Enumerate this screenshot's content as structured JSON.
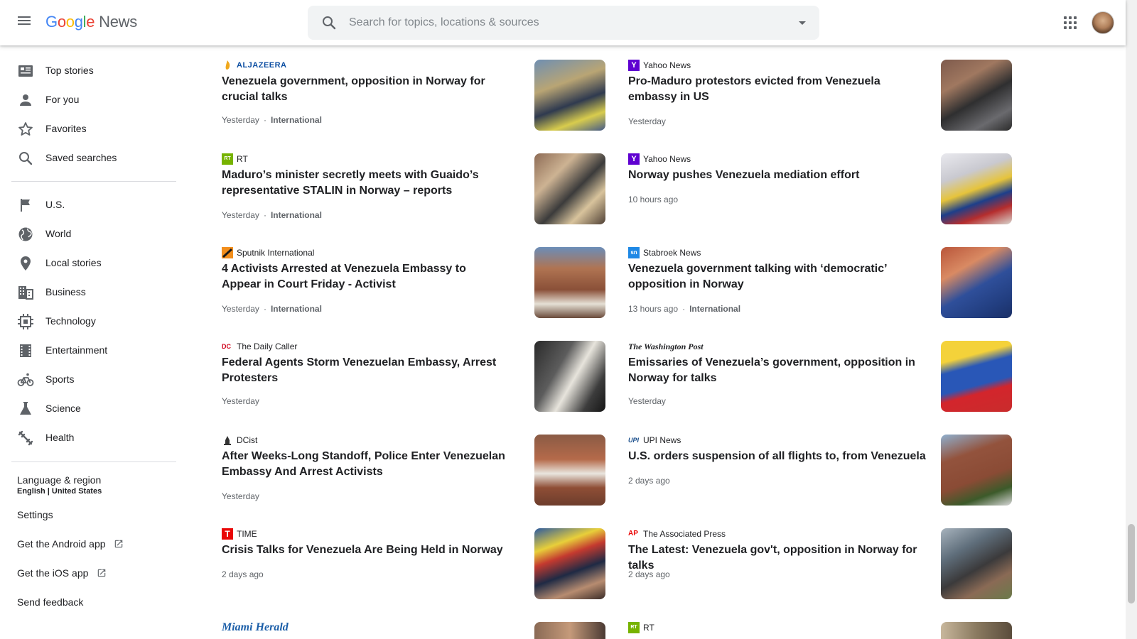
{
  "header": {
    "logo_google": [
      "G",
      "o",
      "o",
      "g",
      "l",
      "e"
    ],
    "logo_news": "News",
    "search_placeholder": "Search for topics, locations & sources"
  },
  "sidebar": {
    "items": [
      {
        "label": "Top stories",
        "icon": "top-stories-icon"
      },
      {
        "label": "For you",
        "icon": "person-icon"
      },
      {
        "label": "Favorites",
        "icon": "star-icon"
      },
      {
        "label": "Saved searches",
        "icon": "search-icon"
      },
      {
        "label": "U.S.",
        "icon": "flag-icon"
      },
      {
        "label": "World",
        "icon": "globe-icon"
      },
      {
        "label": "Local stories",
        "icon": "location-pin-icon"
      },
      {
        "label": "Business",
        "icon": "business-icon"
      },
      {
        "label": "Technology",
        "icon": "chip-icon"
      },
      {
        "label": "Entertainment",
        "icon": "film-icon"
      },
      {
        "label": "Sports",
        "icon": "bike-icon"
      },
      {
        "label": "Science",
        "icon": "flask-icon"
      },
      {
        "label": "Health",
        "icon": "dumbbell-icon"
      }
    ],
    "language_label": "Language & region",
    "language_value": "English | United States",
    "settings": "Settings",
    "android": "Get the Android app",
    "ios": "Get the iOS app",
    "feedback": "Send feedback"
  },
  "articles_left": [
    {
      "source": "ALJAZEERA",
      "title": "Venezuela government, opposition in Norway for crucial talks",
      "time": "Yesterday",
      "category": "International",
      "favicon": "aljazeera-icon"
    },
    {
      "source": "RT",
      "title": "Maduro’s minister secretly meets with Guaido’s representative STALIN in Norway – reports",
      "time": "Yesterday",
      "category": "International",
      "favicon": "rt-icon"
    },
    {
      "source": "Sputnik International",
      "title": "4 Activists Arrested at Venezuela Embassy to Appear in Court Friday - Activist",
      "time": "Yesterday",
      "category": "International",
      "favicon": "sputnik-icon"
    },
    {
      "source": "The Daily Caller",
      "title": "Federal Agents Storm Venezuelan Embassy, Arrest Protesters",
      "time": "Yesterday",
      "category": "",
      "favicon": "daily-caller-icon"
    },
    {
      "source": "DCist",
      "title": "After Weeks-Long Standoff, Police Enter Venezuelan Embassy And Arrest Activists",
      "time": "Yesterday",
      "category": "",
      "favicon": "dcist-icon"
    },
    {
      "source": "TIME",
      "title": "Crisis Talks for Venezuela Are Being Held in Norway",
      "time": "2 days ago",
      "category": "",
      "favicon": "time-icon"
    },
    {
      "source": "Miami Herald",
      "title": "",
      "time": "",
      "category": "",
      "favicon": "miami-herald-icon"
    }
  ],
  "articles_right": [
    {
      "source": "Yahoo News",
      "title": "Pro-Maduro protestors evicted from Venezuela embassy in US",
      "time": "Yesterday",
      "category": "",
      "favicon": "yahoo-icon"
    },
    {
      "source": "Yahoo News",
      "title": "Norway pushes Venezuela mediation effort",
      "time": "10 hours ago",
      "category": "",
      "favicon": "yahoo-icon"
    },
    {
      "source": "Stabroek News",
      "title": "Venezuela government talking with ‘democratic’ opposition in Norway",
      "time": "13 hours ago",
      "category": "International",
      "favicon": "stabroek-icon"
    },
    {
      "source": "The Washington Post",
      "title": "Emissaries of Venezuela’s government, opposition in Norway for talks",
      "time": "Yesterday",
      "category": "",
      "favicon": "washington-post-icon"
    },
    {
      "source": "UPI News",
      "title": "U.S. orders suspension of all flights to, from Venezuela",
      "time": "2 days ago",
      "category": "",
      "favicon": "upi-icon"
    },
    {
      "source": "The Associated Press",
      "title": "The Latest: Venezuela gov't, opposition in Norway for talks",
      "time": "2 days ago",
      "category": "",
      "favicon": "ap-icon"
    },
    {
      "source": "RT",
      "title": "",
      "time": "",
      "category": "",
      "favicon": "rt-icon"
    }
  ],
  "meta_separator": "·",
  "colors": {
    "accent_blue": "#4285f4",
    "text_secondary": "#5f6368",
    "rt_green": "#77b300",
    "time_red": "#e90606",
    "yahoo_purple": "#5f01d1"
  }
}
